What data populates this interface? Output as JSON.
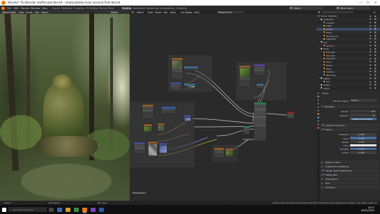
{
  "window": {
    "title": "Blender* [E:\\blender stuff\\sculpt.blend] - empty\\daddy-mojo (second final.blend)",
    "controls": [
      "—",
      "☐",
      "✕"
    ]
  },
  "menubar": {
    "items": [
      "File",
      "Edit",
      "Render",
      "Window",
      "Help"
    ],
    "workspaces": [
      "Layout",
      "Modeling",
      "Sculpting",
      "UV Editing",
      "Texture Paint",
      "Shading",
      "Animation",
      "Rendering",
      "Compositing",
      "Scripting"
    ],
    "active_workspace": "Shading",
    "scene": "Scene",
    "view_layer": "View Layer"
  },
  "viewport": {
    "mode": "Object Mode",
    "menus": [
      "View",
      "Select",
      "Add",
      "Object"
    ],
    "shading": "Global"
  },
  "node_editor": {
    "type": "Object",
    "menus": [
      "View",
      "Select",
      "Add",
      "Node"
    ],
    "use_nodes_label": "Use Nodes",
    "slot": "Slot 1",
    "material": "Material.001",
    "footer_label": "Material.001"
  },
  "outliner": {
    "title": "Scene Collection",
    "rows": [
      {
        "name": "Scene Collection",
        "indent": 2,
        "color": "#8a8a8a"
      },
      {
        "name": "Collection",
        "indent": 6,
        "color": "#cccccc"
      },
      {
        "name": "Camera",
        "indent": 10,
        "color": "#6aa0d0"
      },
      {
        "name": "Light",
        "indent": 10,
        "color": "#d0c060"
      },
      {
        "name": "Sculpt",
        "indent": 10,
        "color": "#e08a3a"
      },
      {
        "name": "Plane",
        "indent": 10,
        "color": "#e08a3a"
      },
      {
        "name": "Background",
        "indent": 10,
        "color": "#e08a3a"
      },
      {
        "name": "Light.001",
        "indent": 10,
        "color": "#d0c060"
      },
      {
        "name": "Env",
        "indent": 6,
        "color": "#cccccc"
      },
      {
        "name": "Ground",
        "indent": 10,
        "color": "#e08a3a"
      },
      {
        "name": "Trees",
        "indent": 6,
        "color": "#cccccc"
      },
      {
        "name": "Tree.001",
        "indent": 10,
        "color": "#e08a3a"
      },
      {
        "name": "Tree.002",
        "indent": 10,
        "color": "#e08a3a"
      },
      {
        "name": "Tree.003",
        "indent": 10,
        "color": "#e08a3a"
      },
      {
        "name": "Ferns",
        "indent": 10,
        "color": "#e08a3a"
      },
      {
        "name": "Rocks",
        "indent": 10,
        "color": "#e08a3a"
      },
      {
        "name": "Moss",
        "indent": 10,
        "color": "#e08a3a"
      },
      {
        "name": "Leaves",
        "indent": 10,
        "color": "#e08a3a"
      },
      {
        "name": "Backdrop",
        "indent": 10,
        "color": "#e08a3a"
      },
      {
        "name": "Lights",
        "indent": 6,
        "color": "#cccccc"
      },
      {
        "name": "Sun",
        "indent": 10,
        "color": "#d0c060"
      },
      {
        "name": "Lights",
        "indent": 6,
        "color": "#cccccc"
      },
      {
        "name": "Lights",
        "indent": 6,
        "color": "#cccccc"
      }
    ],
    "selected_index": 4
  },
  "properties": {
    "header": "Scene",
    "render_engine_label": "Render Engine",
    "render_engine": "Eevee",
    "sampling": {
      "title": "Sampling",
      "render_label": "Render",
      "render_value": "128",
      "viewport_label": "Viewport",
      "viewport_value": "16",
      "denoise_label": "Viewport Denoising"
    },
    "sections": [
      {
        "title": "Ambient Occlusion",
        "checkbox": true
      },
      {
        "title": "Bloom",
        "checkbox": true
      }
    ],
    "bloom_fields": [
      {
        "label": "Threshold",
        "value": "0.800",
        "blue": false
      },
      {
        "label": "Knee",
        "value": "0.500",
        "blue": true
      },
      {
        "label": "Radius",
        "value": "6.500",
        "blue": false
      },
      {
        "label": "Color",
        "value": "",
        "blue": false
      },
      {
        "label": "Intensity",
        "value": "0.050",
        "blue": true
      },
      {
        "label": "Clamp",
        "value": "0.000",
        "blue": false
      }
    ],
    "lower_sections": [
      {
        "title": "Depth of Field",
        "checkbox": false
      },
      {
        "title": "Subsurface Scattering",
        "checkbox": false
      },
      {
        "title": "Screen Space Reflections",
        "checkbox": true
      },
      {
        "title": "Motion Blur",
        "checkbox": true
      },
      {
        "title": "Volumetrics",
        "checkbox": false
      },
      {
        "title": "Hair",
        "checkbox": false
      },
      {
        "title": "Shadows",
        "checkbox": false
      }
    ]
  },
  "statusbar": {
    "left": [
      "Select",
      "Box Select",
      "Pan View"
    ],
    "right": "Sculpt | Verts:4,512,674 | Faces:9,025,278 | Tris:9,025,278 | Objects:1/9 | Mem: 3.91 GiB | v2.80.74"
  },
  "taskbar": {
    "search_placeholder": "Type here to search",
    "time": "18:37",
    "date": "05/02/2019",
    "colors": {
      "brand": "#e87d0d",
      "selection": "#3b4a66",
      "accent": "#4a72b8"
    }
  }
}
